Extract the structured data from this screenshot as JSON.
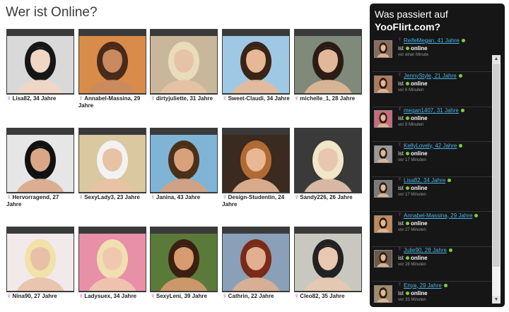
{
  "page": {
    "title": "Wer ist Online?"
  },
  "grid": {
    "female_symbol": "♀",
    "profiles": [
      {
        "caption": "Lisa82, 34 Jahre",
        "bg": "#d9d9d9",
        "skin": "#f0d6c4",
        "hair": "#161616"
      },
      {
        "caption": "Annabel-Massina, 29 Jahre",
        "bg": "#d98c4a",
        "skin": "#c98a60",
        "hair": "#4a2a18"
      },
      {
        "caption": "dirtyjuliette, 31 Jahre",
        "bg": "#c9b79c",
        "skin": "#e6c3a6",
        "hair": "#e8dcbc"
      },
      {
        "caption": "Sweet-Claudi, 34 Jahre",
        "bg": "#9ec8e4",
        "skin": "#e7b896",
        "hair": "#3a2414"
      },
      {
        "caption": "michelle_1, 28 Jahre",
        "bg": "#7f8a7a",
        "skin": "#e2b89a",
        "hair": "#2a1c14"
      },
      {
        "caption": "Hervorragend, 27 Jahre",
        "bg": "#e6e6e6",
        "skin": "#d9a687",
        "hair": "#111111"
      },
      {
        "caption": "SexyLady3, 23 Jahre",
        "bg": "#d9c8a0",
        "skin": "#e8c2a4",
        "hair": "#f2f2f2"
      },
      {
        "caption": "Janina, 43 Jahre",
        "bg": "#7fb4d6",
        "skin": "#d9a07c",
        "hair": "#4a3018"
      },
      {
        "caption": "Design-Studentin, 24 Jahre",
        "bg": "#3a2a20",
        "skin": "#e8b896",
        "hair": "#b06a32"
      },
      {
        "caption": "Sandy226, 26 Jahre",
        "bg": "#3a3a3a",
        "skin": "#e8c6b0",
        "hair": "#f0e6c8"
      },
      {
        "caption": "Nina90, 27 Jahre",
        "bg": "#f2eaea",
        "skin": "#e8c0a8",
        "hair": "#f0e2a8"
      },
      {
        "caption": "Ladysuex, 34 Jahre",
        "bg": "#e890a8",
        "skin": "#f0c8b0",
        "hair": "#f0e0b0"
      },
      {
        "caption": "SexyLeni, 39 Jahre",
        "bg": "#5a7a3a",
        "skin": "#d89a70",
        "hair": "#3a2010"
      },
      {
        "caption": "Cathrin, 22 Jahre",
        "bg": "#8aa0b8",
        "skin": "#e0b090",
        "hair": "#7a2a18"
      },
      {
        "caption": "Cleo82, 35 Jahre",
        "bg": "#c8c8c0",
        "skin": "#e8c8b0",
        "hair": "#222222"
      }
    ]
  },
  "panel": {
    "title_line1": "Was passiert auf",
    "title_line2": "YooFlirt.com?",
    "ist_label": "ist",
    "online_label": "online",
    "feed": [
      {
        "name": "ReifeMegan, 41 Jahre",
        "time": "vor einer Minute",
        "bg": "#8a6a5a"
      },
      {
        "name": "JennyStyle, 21 Jahre",
        "time": "vor 6 Minuten",
        "bg": "#b07a5a"
      },
      {
        "name": "megan1407, 31 Jahre",
        "time": "vor 8 Minuten",
        "bg": "#c86a7a"
      },
      {
        "name": "KellyLovely, 42 Jahre",
        "time": "vor 17 Minuten",
        "bg": "#9a9a9a"
      },
      {
        "name": "Lisa82, 34 Jahre",
        "time": "vor 17 Minuten",
        "bg": "#7a7a7a"
      },
      {
        "name": "Annabel-Massina, 29 Jahre",
        "time": "vor 27 Minuten",
        "bg": "#c08a5a"
      },
      {
        "name": "Julie90, 28 Jahre",
        "time": "vor 28 Minuten",
        "bg": "#6a5a4a"
      },
      {
        "name": "Enya, 29 Jahre",
        "time": "vor 33 Minuten",
        "bg": "#a08a6a"
      }
    ]
  },
  "scrollbar": {
    "up_glyph": "▲",
    "down_glyph": "▼"
  }
}
